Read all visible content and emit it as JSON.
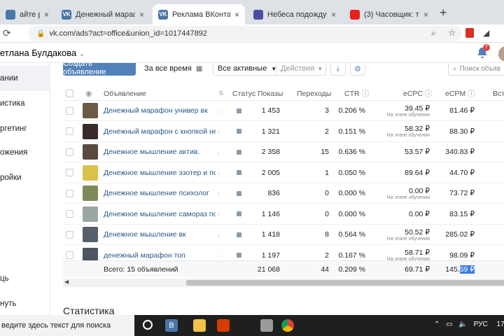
{
  "browser": {
    "tabs": [
      {
        "title": "айте рекламу с",
        "color": "#4a76a8",
        "active": false
      },
      {
        "title": "Денежный марафон...",
        "color": "#4a76a8",
        "active": false
      },
      {
        "title": "Реклама ВКонтакте",
        "color": "#4a76a8",
        "active": true
      },
      {
        "title": "Небеса подождут. Се...",
        "color": "#4b4e9e",
        "active": false
      },
      {
        "title": "(3) Часовщик: три в р...",
        "color": "#e62117",
        "active": false
      }
    ],
    "favicon_vk": "VK",
    "new_tab_label": "+",
    "url": "vk.com/ads?act=office&union_id=1017447892"
  },
  "header": {
    "username": "етлана Булдакова",
    "notification_count": "7"
  },
  "sidebar": {
    "items": [
      {
        "label": "ании",
        "active": true
      },
      {
        "label": "истика",
        "active": false
      },
      {
        "label": "ргетинг",
        "active": false
      },
      {
        "label": "ожения",
        "active": false
      },
      {
        "label": "ройки",
        "active": false
      },
      {
        "label": "ць",
        "active": false
      },
      {
        "label": "нуть",
        "active": false
      }
    ]
  },
  "toolbar": {
    "create_label": "Создать объявление",
    "period_label": "За все время",
    "filter_label": "Все активные",
    "actions_label": "Действия",
    "search_placeholder": "Поиск объяв"
  },
  "table": {
    "columns": {
      "ad": "Объявление",
      "status": "Статус",
      "impressions": "Показы",
      "clicks": "Переходы",
      "ctr": "CTR",
      "ecpc": "eCPC",
      "ecpm": "eCPM",
      "joins": "Вступ"
    },
    "rows": [
      {
        "name": "Денежный марафон универ вк",
        "impressions": "1 453",
        "clicks": "3",
        "ctr": "0.206 %",
        "ecpc": "39.45 ₽",
        "ecpc_note": "На этапе обучения",
        "ecpm": "81.46 ₽",
        "thumb": "#6b5a48"
      },
      {
        "name": "Денежный марафон с кнопкой неда...",
        "impressions": "1 321",
        "clicks": "2",
        "ctr": "0.151 %",
        "ecpc": "58.32 ₽",
        "ecpc_note": "На этапе обучения",
        "ecpm": "88.30 ₽",
        "thumb": "#3a2b2b"
      },
      {
        "name": "Денежное мышление актив.",
        "impressions": "2 358",
        "clicks": "15",
        "ctr": "0.636 %",
        "ecpc": "53.57 ₽",
        "ecpc_note": "",
        "ecpm": "340.83 ₽",
        "thumb": "#5a4a40"
      },
      {
        "name": "Денежное мышление эзотер и псих",
        "impressions": "2 005",
        "clicks": "1",
        "ctr": "0.050 %",
        "ecpc": "89.64 ₽",
        "ecpc_note": "",
        "ecpm": "44.70 ₽",
        "thumb": "#d9c24a"
      },
      {
        "name": "Денежное мышление психолог",
        "impressions": "836",
        "clicks": "0",
        "ctr": "0.000 %",
        "ecpc": "0.00 ₽",
        "ecpc_note": "На этапе обучения",
        "ecpm": "73.72 ₽",
        "thumb": "#7e8a5a"
      },
      {
        "name": "Денежное мышление самораз пси...",
        "impressions": "1 146",
        "clicks": "0",
        "ctr": "0.000 %",
        "ecpc": "0.00 ₽",
        "ecpc_note": "",
        "ecpm": "83.15 ₽",
        "thumb": "#9aa7a2"
      },
      {
        "name": "Денежное мышление вк",
        "impressions": "1 418",
        "clicks": "8",
        "ctr": "0.564 %",
        "ecpc": "50.52 ₽",
        "ecpc_note": "На этапе обучения",
        "ecpm": "285.02 ₽",
        "thumb": "#55606a"
      },
      {
        "name": "денежный марафон топ",
        "impressions": "1 197",
        "clicks": "2",
        "ctr": "0.167 %",
        "ecpc": "58.71 ₽",
        "ecpc_note": "На этапе обучения",
        "ecpm": "98.09 ₽",
        "thumb": "#4c5560"
      }
    ],
    "totals": {
      "label": "Всего: 15 объявлений",
      "impressions": "21 068",
      "clicks": "44",
      "ctr": "0.209 %",
      "ecpc": "69.71 ₽",
      "ecpm_plain": "145.",
      "ecpm_selected": "59 ₽"
    }
  },
  "section_title": "Статистика",
  "taskbar": {
    "search_text": "ведите здесь текст для поиска",
    "lang": "РУС",
    "time": "17"
  }
}
